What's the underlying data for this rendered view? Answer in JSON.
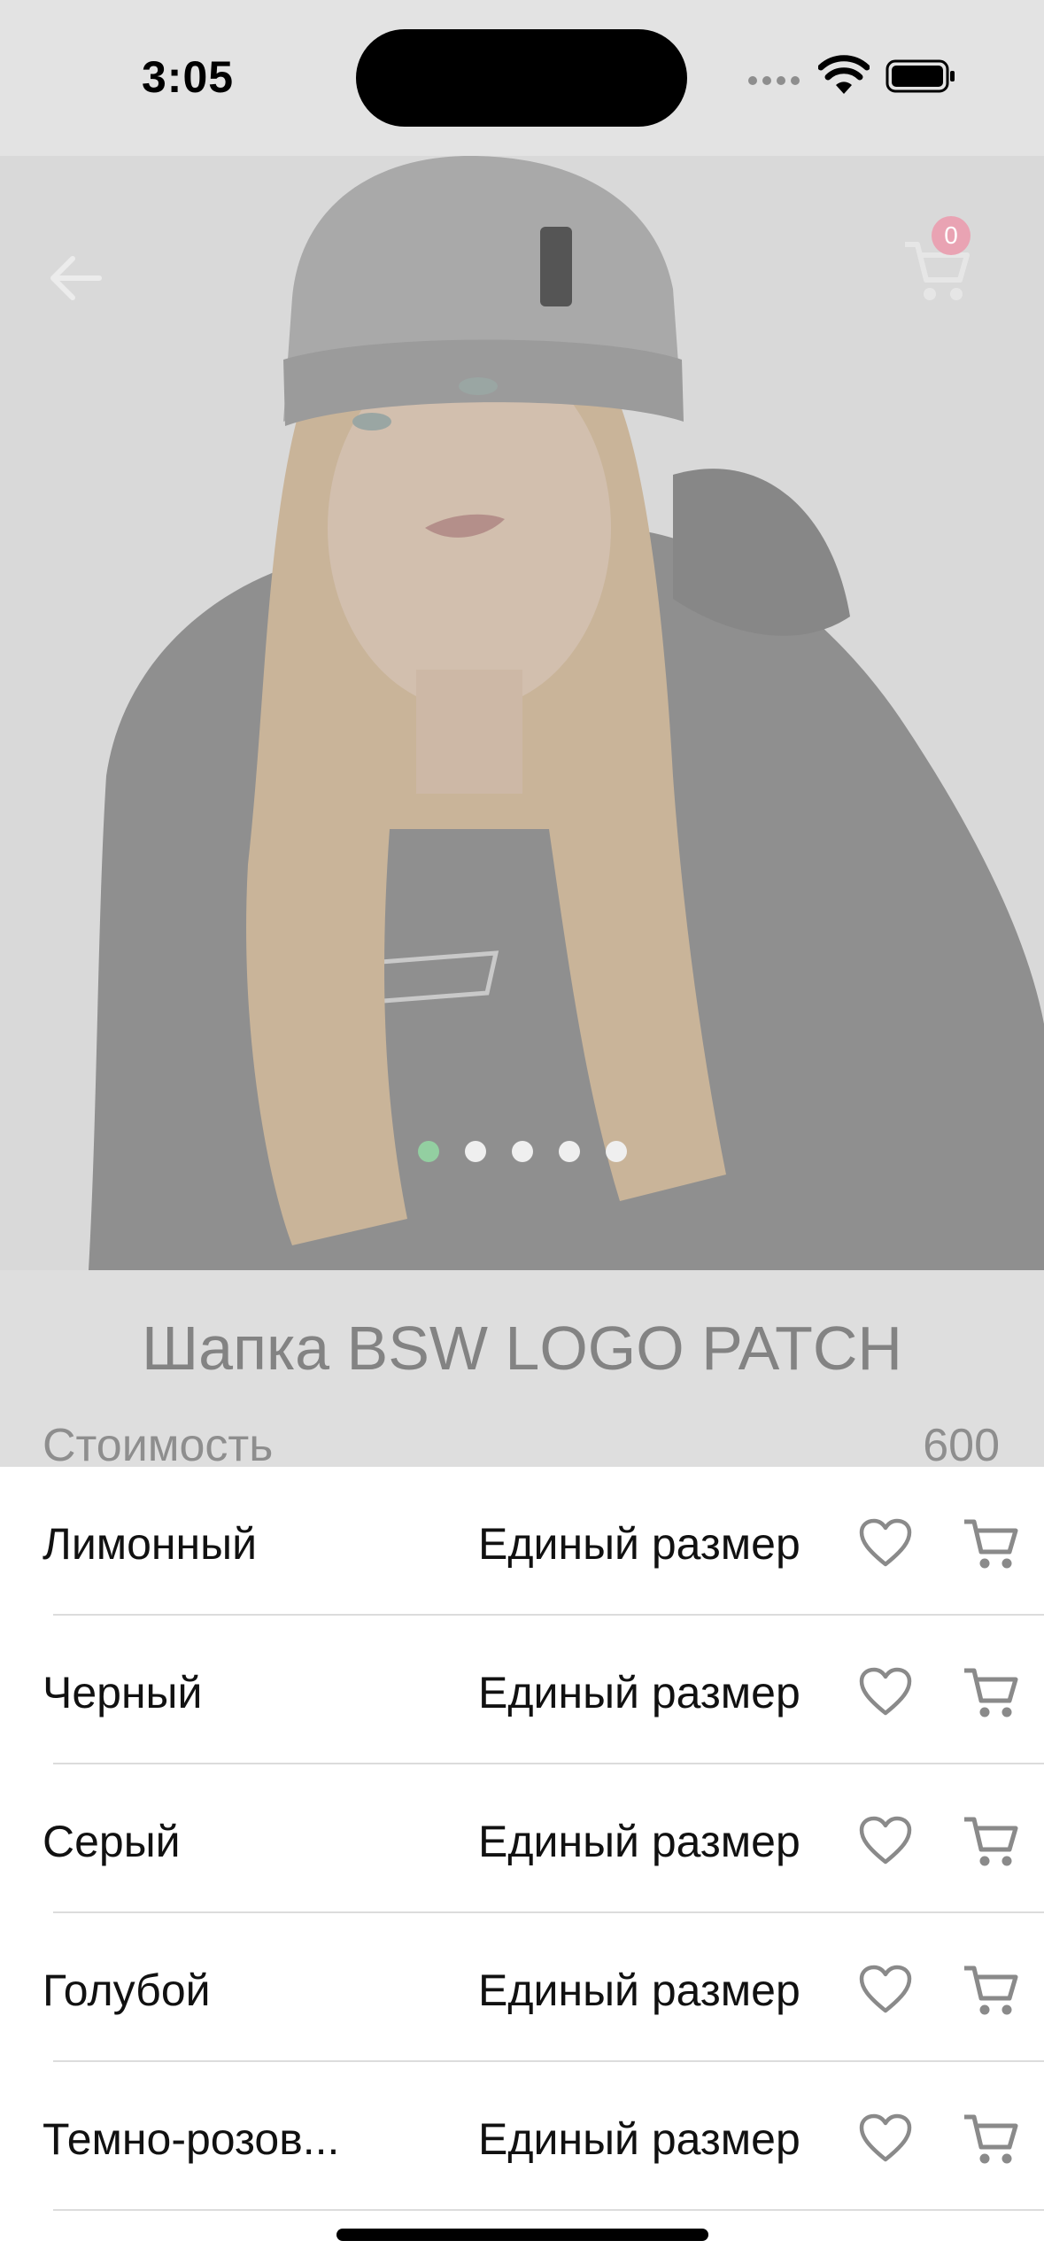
{
  "status_bar": {
    "time": "3:05"
  },
  "header": {
    "cart_count": "0",
    "accent_color": "#93cfa1",
    "badge_color": "#e9a3b3"
  },
  "gallery": {
    "page_count": 5,
    "active_index": 0
  },
  "product": {
    "title": "Шапка BSW LOGO PATCH",
    "price_label": "Стоимость",
    "price_value": "600"
  },
  "variants": [
    {
      "color": "Лимонный",
      "size": "Единый размер"
    },
    {
      "color": "Черный",
      "size": "Единый размер"
    },
    {
      "color": "Серый",
      "size": "Единый размер"
    },
    {
      "color": "Голубой",
      "size": "Единый размер"
    },
    {
      "color": "Темно-розов...",
      "size": "Единый размер"
    }
  ],
  "icons": {
    "back": "arrow-left-icon",
    "cart": "cart-icon",
    "favorite": "heart-outline-icon"
  }
}
